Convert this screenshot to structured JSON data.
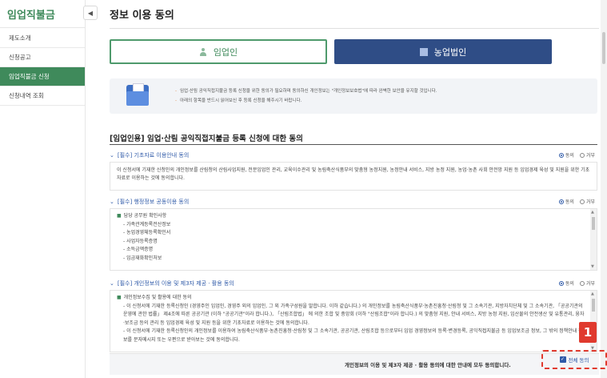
{
  "sidebar": {
    "title": "임업직불금",
    "collapse_icon": "◀",
    "items": [
      {
        "label": "제도소개",
        "active": false
      },
      {
        "label": "신청공고",
        "active": false
      },
      {
        "label": "임업직불금 신청",
        "active": true
      },
      {
        "label": "신청내역 조회",
        "active": false
      }
    ]
  },
  "page": {
    "title": "정보 이용 동의"
  },
  "applicant_type": {
    "person_label": "임업인",
    "corp_label": "농업법인"
  },
  "notice": {
    "lines": [
      "임업·산림 공익직접지불금 등록 신청을 위한 동의가 필요하며 동의하신 개인정보는 \"개인정보보호법\"에 따라 완벽한 보안을 유지할 것입니다.",
      "아래의 항목을 반드시 읽어보신 후 등록 신청을 해주시기 바랍니다."
    ]
  },
  "section": {
    "heading": "[임업인용] 임업·산림 공익직접지불금 등록 신청에 대한 동의"
  },
  "agreements": [
    {
      "title": "[필수] 기초자료 이용안내 동의",
      "agree": "동의",
      "reject": "거부",
      "text": "이 신청서에 기재한 신청인의 개인정보를 산림청의 산림사업지원, 전문임업인 관리, 교육이수관리 및 농림축산식품부의 맞춤형 농정지원, 농정안내 서비스, 지방 농정 지원, 농업·농촌 사회 안전망 지원 등 임업경제 육성 및 지원을 위한 기초자료로 이용하는 것에 동의합니다."
    },
    {
      "title": "[필수] 행정정보 공동이용 동의",
      "agree": "동의",
      "reject": "거부",
      "head": "담당 공무원 확인사항",
      "items": [
        "가족관계등록전산정보",
        "농업경영체등록확인서",
        "사업자등록증명",
        "소득금액증명",
        "임금재화확인처보"
      ]
    },
    {
      "title": "[필수] 개인정보의 이용 및 제3자 제공 · 활용 동의",
      "agree": "동의",
      "reject": "거부",
      "head": "개인정보수집 및 활용에 대한 동의",
      "paragraphs": [
        "이 신청서에 기재한 등록신청인 (경영주인 임업인, 경영주 외의 임업인, 그 외 가족구성원을 말합니다. 이하 같습니다.)  의 개인정보를 농림축산식품부·농촌진흥청·산림청 및 그 소속기관, 지방자치단체 및 그 소속기관, 「공공기관의 운영에 관한 법률」 제4조에 따른 공공기관 (이하 \"공공기관\"이라 합니다.), 「산림조합법」 에 의한 조합 및 중앙회 (이하 \"산림조합\"이라 합니다.) 의 맞춤형 지원,  안내 서비스,  지방 농정 지원,  임산물의 안전생산 및 유통관리, 융자·보조금 등의 관리 등 임업경제 육성 및 지원 등을 위한 기초자료로 이용하는 것에 동의합니다.",
        "이 신청서에 기재한 등록신청인의 개인정보를 이용하여 농림축산식품부·농촌진흥청·산림청 및 그 소속기관, 공공기관, 산림조합 등으로부터 임업 경영정보의 등록·변경등록, 공익직접지불금 등 임업보조금 정보, 그 밖의 정책안내 정보를 문자메시지 또는 우편으로 받아보는 것에 동의합니다."
      ]
    }
  ],
  "footer": {
    "text": "개인정보의 이용 및 제3자 제공 · 활용 동의에 대한 안내에 모두 동의합니다.",
    "all_agree_label": "전체 동의",
    "badge": "1"
  },
  "colors": {
    "brand_green": "#3f8a5b",
    "corp_blue": "#2f4d86",
    "link_blue": "#2f5aa8",
    "highlight_red": "#e03a2e"
  }
}
